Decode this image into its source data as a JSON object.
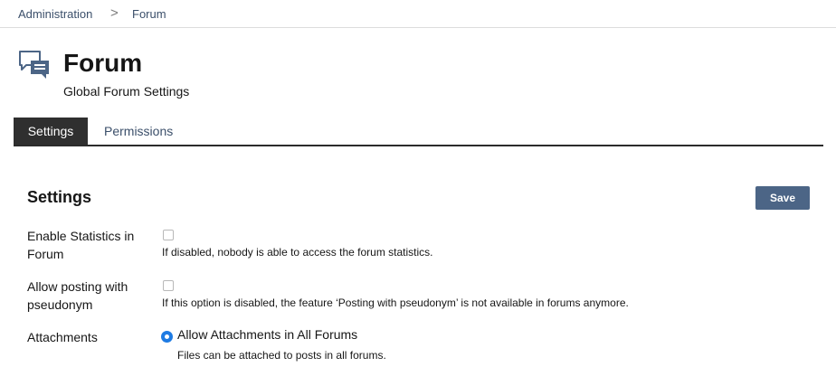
{
  "breadcrumb": {
    "items": [
      "Administration",
      "Forum"
    ],
    "separator": ">"
  },
  "header": {
    "icon": "forum-chat-icon",
    "title": "Forum",
    "subtitle": "Global Forum Settings"
  },
  "tabs": [
    {
      "label": "Settings",
      "active": true
    },
    {
      "label": "Permissions",
      "active": false
    }
  ],
  "settings": {
    "title": "Settings",
    "save_label": "Save",
    "rows": [
      {
        "label": "Enable Statistics in Forum",
        "checked": false,
        "hint": "If disabled, nobody is able to access the forum statistics."
      },
      {
        "label": "Allow posting with pseudonym",
        "checked": false,
        "hint": "If this option is disabled, the feature ‘Posting with pseudonym’ is not available in forums anymore."
      }
    ],
    "attachments": {
      "label": "Attachments",
      "selected_option": "Allow Attachments in All Forums",
      "hint": "Files can be attached to posts in all forums."
    }
  },
  "colors": {
    "accent": "#4c6586",
    "radio": "#1e7be3",
    "active_tab": "#2f2f2f",
    "link": "#3b4f6a"
  }
}
